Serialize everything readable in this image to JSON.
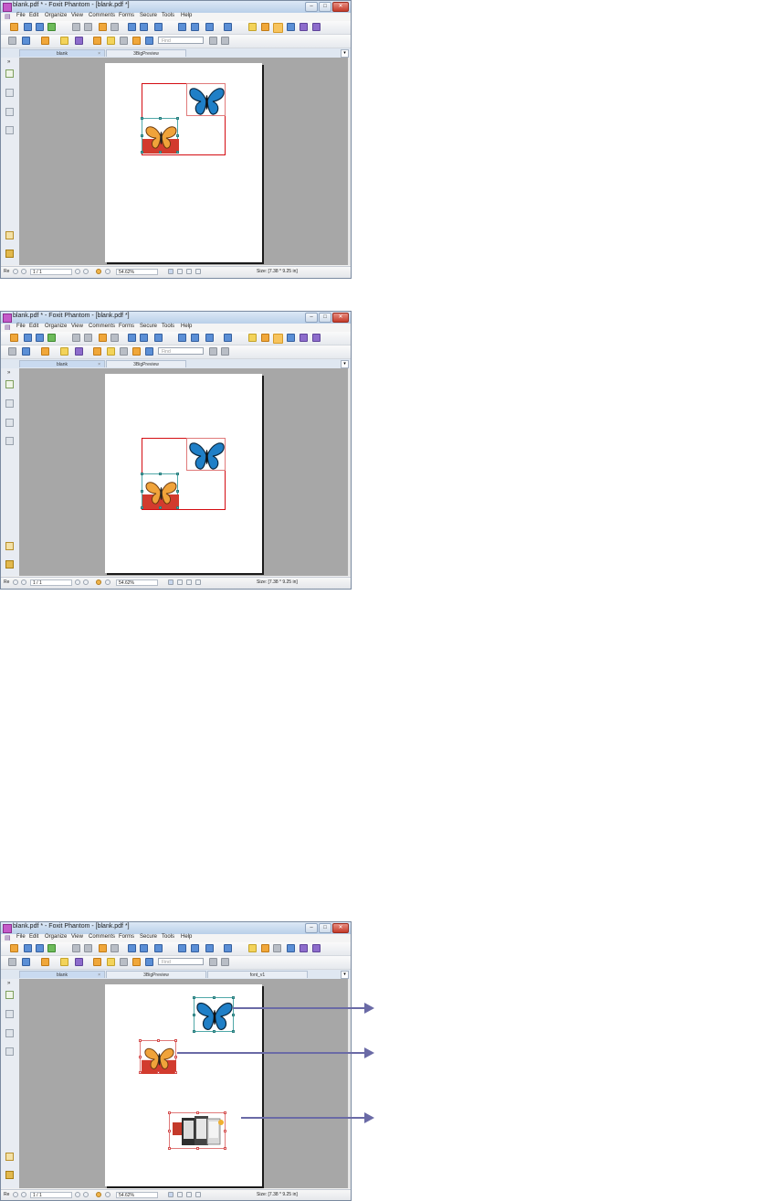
{
  "window": {
    "title": "blank.pdf * - Foxit Phantom - [blank.pdf *]",
    "min_glyph": "–",
    "max_glyph": "□",
    "close_glyph": "✕"
  },
  "menu": [
    "File",
    "Edit",
    "Organize",
    "View",
    "Comments",
    "Forms",
    "Secure",
    "Tools",
    "Help"
  ],
  "toolbar": {
    "find_placeholder": "Find"
  },
  "tabs": {
    "blank": "blank",
    "tab_close_glyph": "×",
    "preview": "3BigPreview",
    "font": "font_v1",
    "dropdown_glyph": "▾"
  },
  "statusbar": {
    "left_label": "Re",
    "page_indicator": "1 / 1",
    "zoom": "54.62%",
    "size": "Size: [7.38 * 9.25 in]"
  },
  "side_toggle_glyph": "»",
  "colors": {
    "accent": "#d40c12",
    "arrow": "#6a6aa6",
    "document_bg": "#a7a7a7"
  }
}
